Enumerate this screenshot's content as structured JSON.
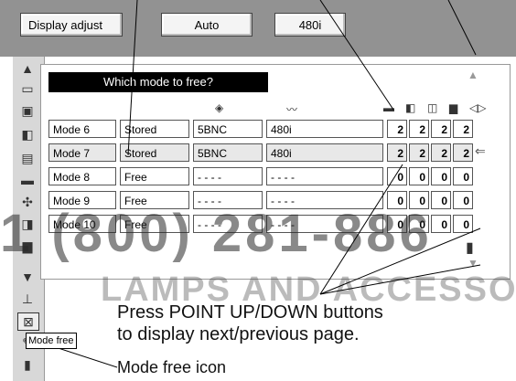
{
  "top_bar": {
    "display_adjust": "Display adjust",
    "auto": "Auto",
    "resolution": "480i"
  },
  "dialog": {
    "title": "Which mode to free?"
  },
  "rows": [
    {
      "mode": "Mode 6",
      "status": "Stored",
      "input": "5BNC",
      "signal": "480i",
      "v": [
        "2",
        "2",
        "2",
        "2"
      ]
    },
    {
      "mode": "Mode 7",
      "status": "Stored",
      "input": "5BNC",
      "signal": "480i",
      "v": [
        "2",
        "2",
        "2",
        "2"
      ]
    },
    {
      "mode": "Mode 8",
      "status": "Free",
      "input": "- - - -",
      "signal": "- - - -",
      "v": [
        "0",
        "0",
        "0",
        "0"
      ]
    },
    {
      "mode": "Mode 9",
      "status": "Free",
      "input": "- - - -",
      "signal": "- - - -",
      "v": [
        "0",
        "0",
        "0",
        "0"
      ]
    },
    {
      "mode": "Mode 10",
      "status": "Free",
      "input": "- - - -",
      "signal": "- - - -",
      "v": [
        "0",
        "0",
        "0",
        "0"
      ]
    }
  ],
  "selected_row": "Mode 7",
  "tooltip": "Mode free",
  "instruction_line1": "Press POINT UP/DOWN buttons",
  "instruction_line2": "to display next/previous page.",
  "caption": "Mode free icon",
  "watermark": "1 (800) 281-886",
  "watermark2": "LAMPS AND ACCESSORIES",
  "icons": {
    "sidebar": [
      "up-triangle-icon",
      "monitor-icon",
      "input-icon",
      "adjust-icon",
      "memory-icon",
      "screen-icon",
      "keystone-icon",
      "mode-icon",
      "store-icon",
      "down-triangle-icon",
      "lamp-icon",
      "mode-free-icon",
      "free-icon",
      "exit-icon"
    ]
  }
}
